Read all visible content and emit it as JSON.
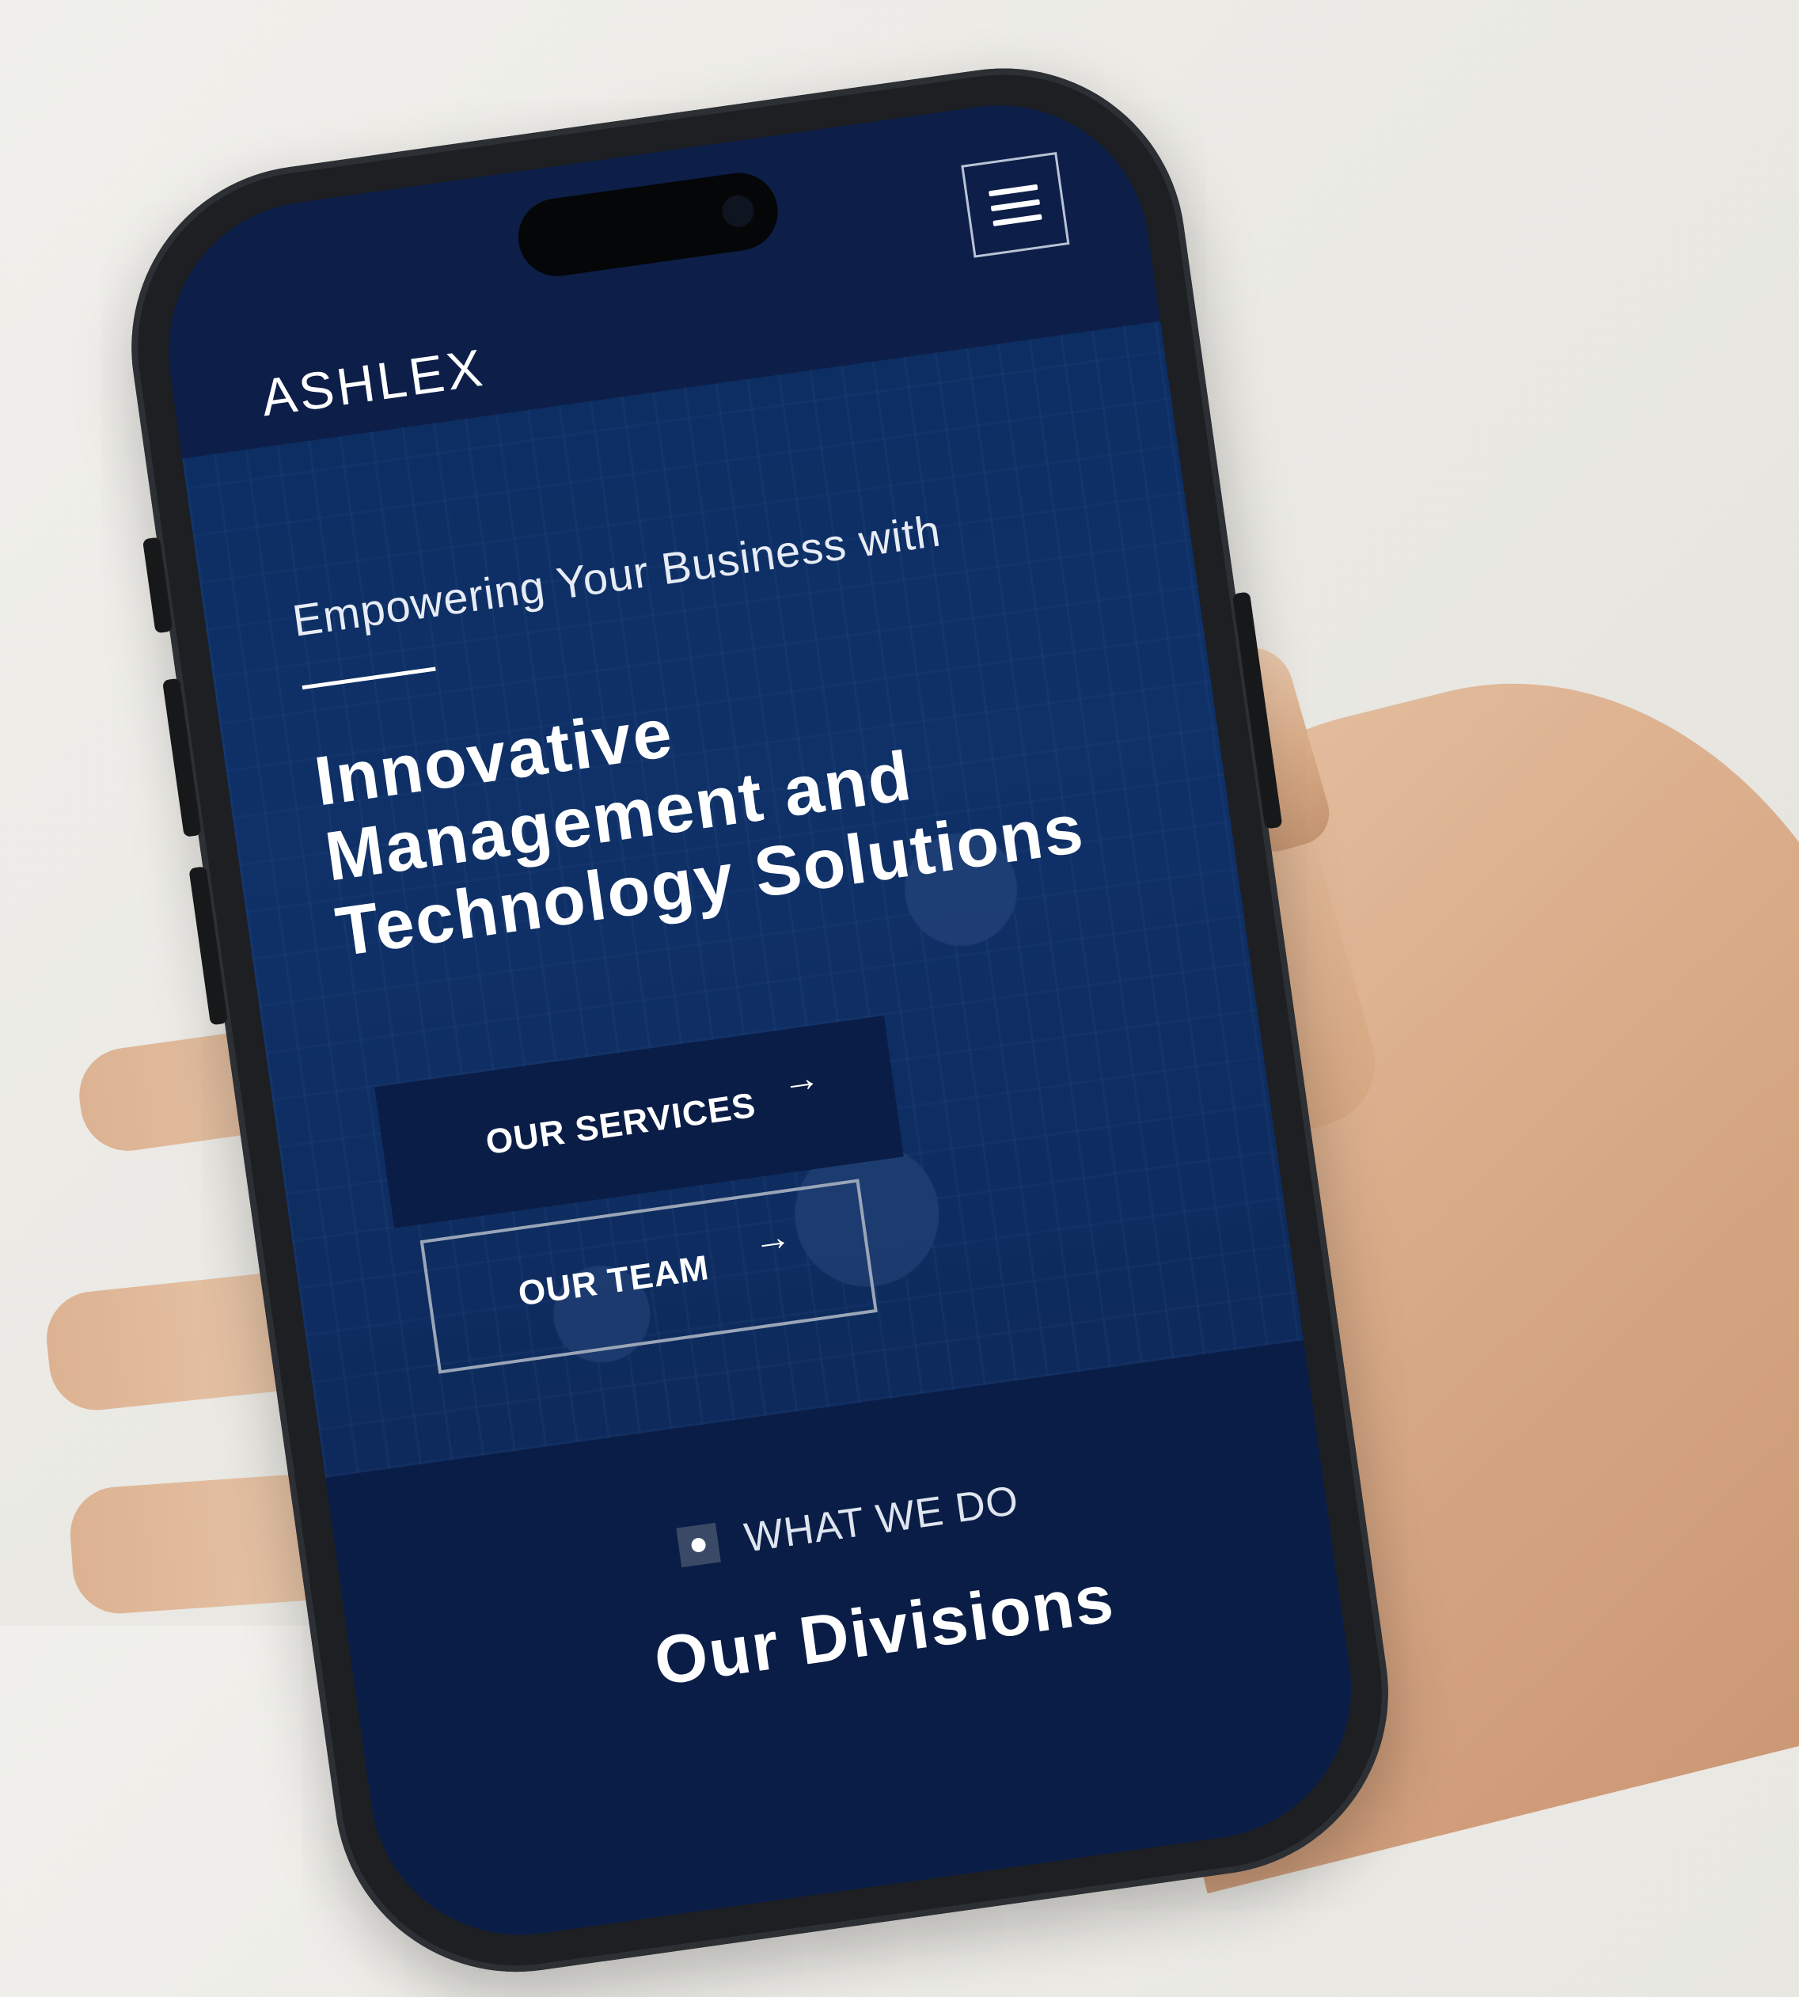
{
  "header": {
    "logo": "ASHLEX",
    "menu_icon": "hamburger-menu-icon"
  },
  "hero": {
    "eyebrow": "Empowering Your Business with",
    "title_lines": [
      "Innovative",
      "Management and",
      "Technology Solutions"
    ],
    "buttons": {
      "services_label": "OUR SERVICES",
      "team_label": "OUR TEAM",
      "arrow": "→"
    }
  },
  "divisions": {
    "eyebrow": "WHAT WE DO",
    "title": "Our Divisions"
  },
  "colors": {
    "navy_dark": "#0a1d47",
    "navy_hero": "#0f3168",
    "white": "#ffffff",
    "outline": "#9aa6b8"
  }
}
